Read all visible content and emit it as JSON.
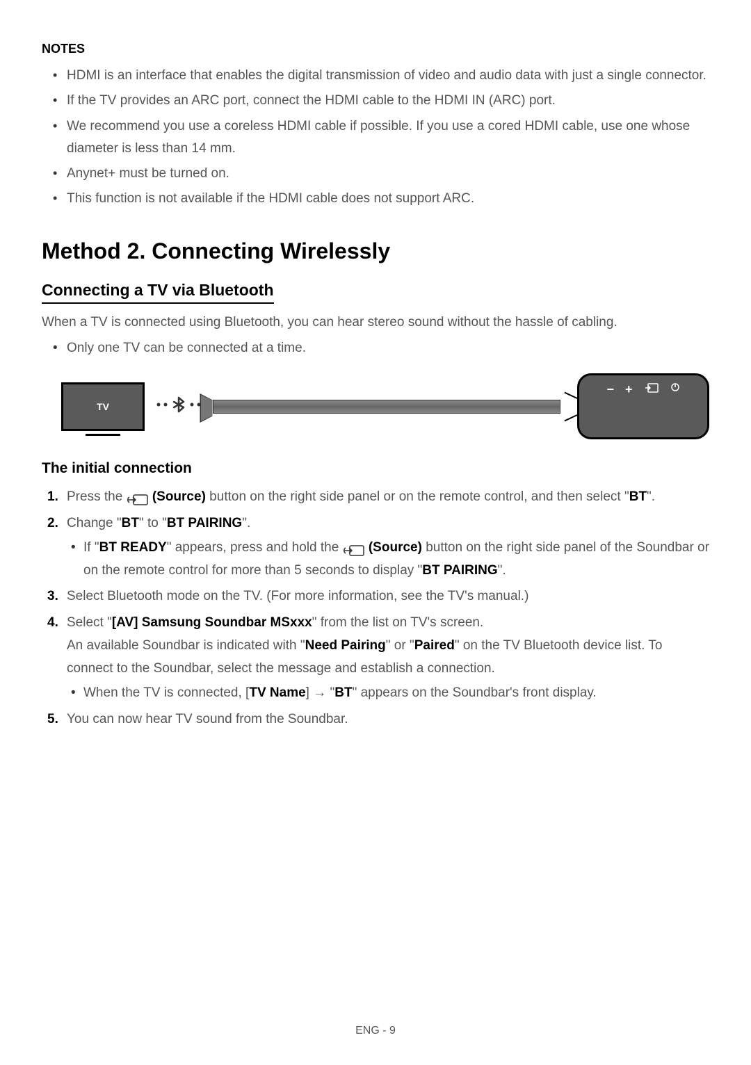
{
  "notes": {
    "header": "NOTES",
    "items": [
      "HDMI is an interface that enables the digital transmission of video and audio data with just a single connector.",
      "If the TV provides an ARC port, connect the HDMI cable to the HDMI IN (ARC) port.",
      "We recommend you use a coreless HDMI cable if possible. If you use a cored HDMI cable, use one whose diameter is less than 14 mm.",
      "Anynet+ must be turned on.",
      "This function is not available if the HDMI cable does not support ARC."
    ]
  },
  "method": {
    "title": "Method 2. Connecting Wirelessly",
    "subsection": "Connecting a TV via Bluetooth",
    "description": "When a TV is connected using Bluetooth, you can hear stereo sound without the hassle of cabling.",
    "sublist": [
      "Only one TV can be connected at a time."
    ]
  },
  "diagram": {
    "tv_label": "TV",
    "panel": {
      "minus": "−",
      "plus": "+"
    }
  },
  "initial": {
    "heading": "The initial connection",
    "step1_pre": "Press the ",
    "step1_source": " (Source)",
    "step1_post": " button on the right side panel or on the remote control, and then select \"",
    "step1_bt": "BT",
    "step1_end": "\".",
    "step2_pre": "Change \"",
    "step2_bt": "BT",
    "step2_mid": "\" to \"",
    "step2_pairing": "BT PAIRING",
    "step2_end": "\".",
    "step2_nested_pre": "If \"",
    "step2_nested_ready": "BT READY",
    "step2_nested_mid1": "\" appears, press and hold the ",
    "step2_nested_source": " (Source)",
    "step2_nested_mid2": " button on the right side panel of the Soundbar or on the remote control for more than 5 seconds to display \"",
    "step2_nested_pairing": "BT PAIRING",
    "step2_nested_end": "\".",
    "step3": "Select Bluetooth mode on the TV. (For more information, see the TV's manual.)",
    "step4_pre": "Select \"",
    "step4_device": "[AV] Samsung Soundbar MSxxx",
    "step4_post": "\" from the list on TV's screen.",
    "step4_line2_pre": "An available Soundbar is indicated with \"",
    "step4_needpairing": "Need Pairing",
    "step4_line2_mid": "\" or \"",
    "step4_paired": "Paired",
    "step4_line2_post": "\" on the TV Bluetooth device list. To connect to the Soundbar, select the message and establish a connection.",
    "step4_nested_pre": "When the TV is connected, [",
    "step4_tvname": "TV Name",
    "step4_nested_mid": "] → \"",
    "step4_nested_bt": "BT",
    "step4_nested_post": "\" appears on the Soundbar's front display.",
    "step5": "You can now hear TV sound from the Soundbar."
  },
  "footer": "ENG - 9"
}
